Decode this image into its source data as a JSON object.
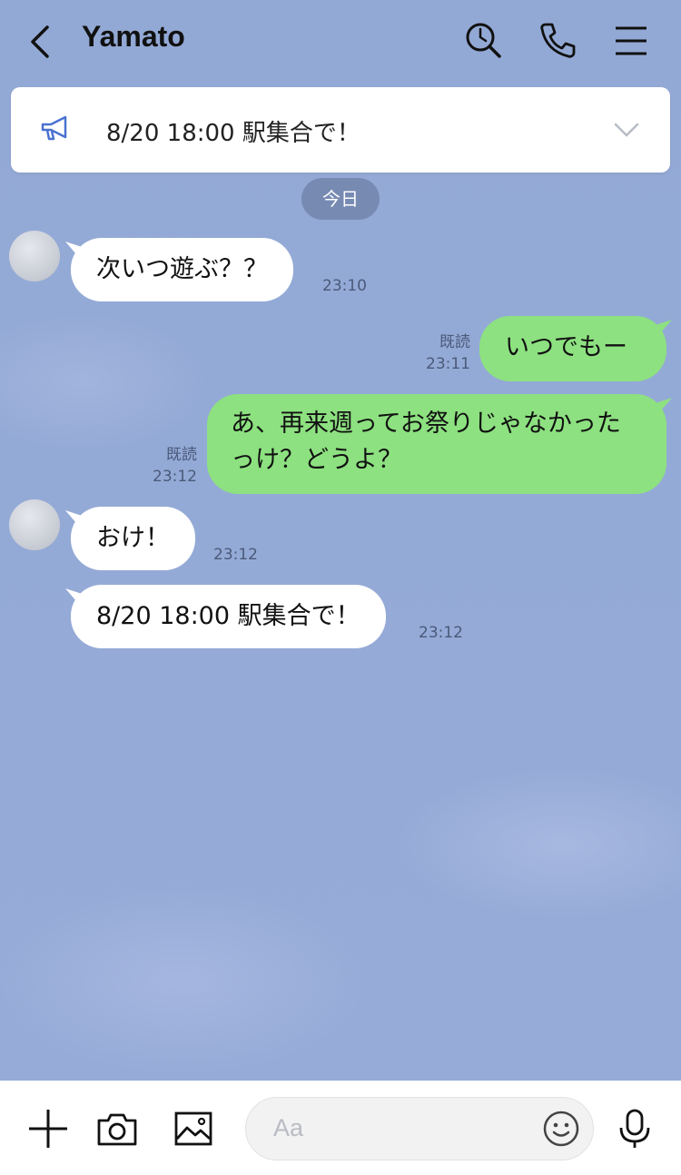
{
  "header": {
    "title": "Yamato",
    "icons": [
      "back-icon",
      "search-icon",
      "phone-icon",
      "menu-icon"
    ]
  },
  "announcement": {
    "text": "8/20 18:00 駅集合で！",
    "icons": [
      "megaphone-icon",
      "chevron-down-icon"
    ]
  },
  "date_divider": "今日",
  "messages": [
    {
      "side": "in",
      "text": "次いつ遊ぶ？？",
      "time": "23:10",
      "read": ""
    },
    {
      "side": "out",
      "text": "いつでもー",
      "time": "23:11",
      "read": "既読"
    },
    {
      "side": "out",
      "text": "あ、再来週ってお祭りじゃなかったっけ？どうよ？",
      "time": "23:12",
      "read": "既読"
    },
    {
      "side": "in",
      "text": "おけ！",
      "time": "23:12",
      "read": ""
    },
    {
      "side": "in",
      "text": "8/20 18:00 駅集合で！",
      "time": "23:12",
      "read": ""
    }
  ],
  "composer": {
    "placeholder": "Aa",
    "icons": [
      "plus-icon",
      "camera-icon",
      "image-icon",
      "emoji-icon",
      "mic-icon"
    ]
  },
  "colors": {
    "background": "#93a9d5",
    "incoming_bubble": "#ffffff",
    "outgoing_bubble": "#8de180",
    "date_pill": "#6e80a6"
  }
}
